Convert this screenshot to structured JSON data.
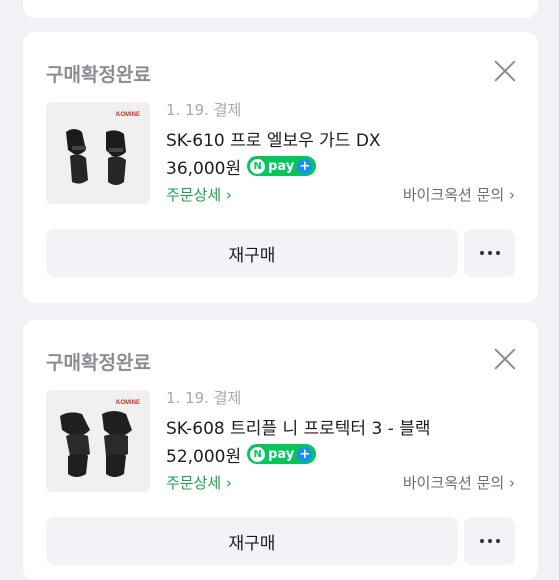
{
  "orders": [
    {
      "status": "구매확정완료",
      "date": "1. 19. 결제",
      "product_name": "SK-610 프로 엘보우 가드 DX",
      "price": "36,000원",
      "pay_badge": "pay",
      "pay_badge_n": "N",
      "pay_badge_plus": "+",
      "detail_link": "주문상세 ›",
      "seller_inquiry": "바이크옥션 문의 ›",
      "rebuy_label": "재구매",
      "close_icon": "close-icon",
      "more_icon": "more-horizontal-icon"
    },
    {
      "status": "구매확정완료",
      "date": "1. 19. 결제",
      "product_name": "SK-608 트리플 니 프로텍터 3 - 블랙",
      "price": "52,000원",
      "pay_badge": "pay",
      "pay_badge_n": "N",
      "pay_badge_plus": "+",
      "detail_link": "주문상세 ›",
      "seller_inquiry": "바이크옥션 문의 ›",
      "rebuy_label": "재구매",
      "close_icon": "close-icon",
      "more_icon": "more-horizontal-icon"
    }
  ],
  "colors": {
    "page_bg": "#f1f2f6",
    "card_bg": "#ffffff",
    "status_gray": "#8a8d93",
    "npay_green": "#03c75a",
    "detail_green": "#1aa64b"
  }
}
